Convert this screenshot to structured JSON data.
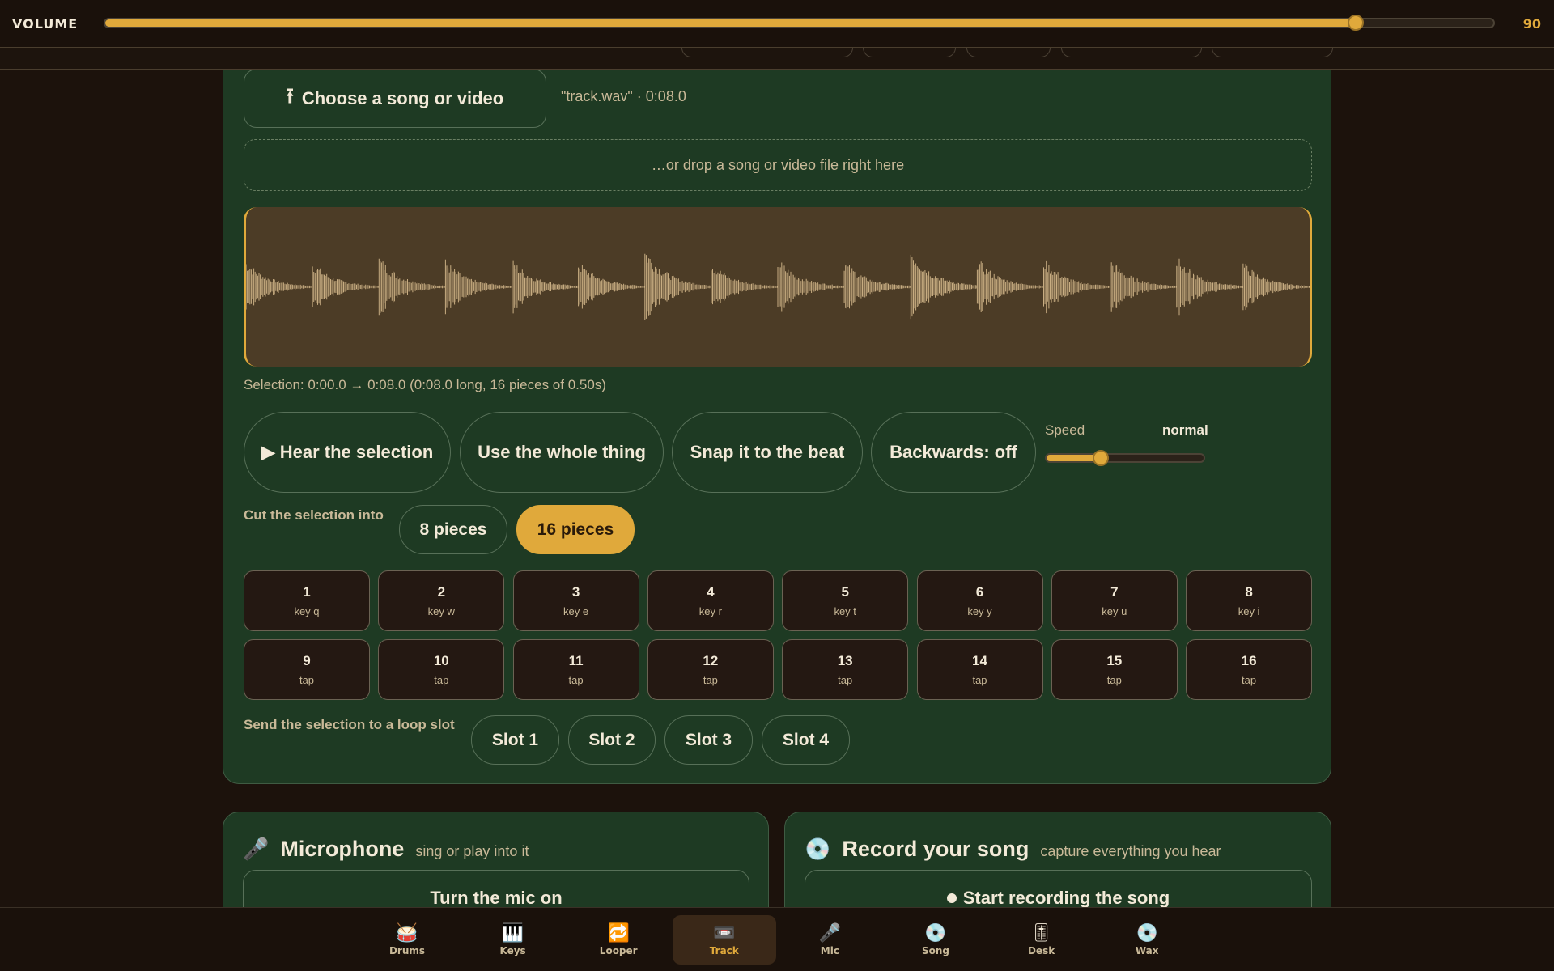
{
  "volume": {
    "label": "VOLUME",
    "value": "90",
    "level": 0.9
  },
  "track": {
    "choose_icon": "upload-icon",
    "choose_label": "Choose a song or video",
    "file_info": "\"track.wav\" · 0:08.0",
    "dropzone_text": "…or drop a song or video file right here",
    "selection_text": "Selection: 0:00.0 → 0:08.0 (0:08.0 long, 16 pieces of 0.50s)",
    "buttons": {
      "hear": "▶ Hear the selection",
      "whole": "Use the whole thing",
      "snap": "Snap it to the beat",
      "backwards": "Backwards: off"
    },
    "speed": {
      "label": "Speed",
      "value": "normal",
      "level": 0.35
    },
    "cut_label": "Cut the selection into",
    "cut_options": [
      "8 pieces",
      "16 pieces"
    ],
    "cut_selected": "16 pieces",
    "pads": [
      {
        "num": "1",
        "sub": "key q"
      },
      {
        "num": "2",
        "sub": "key w"
      },
      {
        "num": "3",
        "sub": "key e"
      },
      {
        "num": "4",
        "sub": "key r"
      },
      {
        "num": "5",
        "sub": "key t"
      },
      {
        "num": "6",
        "sub": "key y"
      },
      {
        "num": "7",
        "sub": "key u"
      },
      {
        "num": "8",
        "sub": "key i"
      },
      {
        "num": "9",
        "sub": "tap"
      },
      {
        "num": "10",
        "sub": "tap"
      },
      {
        "num": "11",
        "sub": "tap"
      },
      {
        "num": "12",
        "sub": "tap"
      },
      {
        "num": "13",
        "sub": "tap"
      },
      {
        "num": "14",
        "sub": "tap"
      },
      {
        "num": "15",
        "sub": "tap"
      },
      {
        "num": "16",
        "sub": "tap"
      }
    ],
    "send_label": "Send the selection to a loop slot",
    "slots": [
      "Slot 1",
      "Slot 2",
      "Slot 3",
      "Slot 4"
    ],
    "waveform": {
      "color_wave": "#c8ad82",
      "color_bg": "#4c3c26",
      "color_edge": "#e0a93b"
    }
  },
  "microphone": {
    "icon": "microphone-icon",
    "emoji": "🎤",
    "title": "Microphone",
    "subtitle": "sing or play into it",
    "button": "Turn the mic on"
  },
  "record": {
    "icon": "disc-icon",
    "emoji": "💿",
    "title": "Record your song",
    "subtitle": "capture everything you hear",
    "button": "Start recording the song"
  },
  "nav": [
    {
      "label": "Drums",
      "icon": "drum-icon",
      "glyph": "🥁"
    },
    {
      "label": "Keys",
      "icon": "piano-icon",
      "glyph": "🎹"
    },
    {
      "label": "Looper",
      "icon": "loop-icon",
      "glyph": "🔁"
    },
    {
      "label": "Track",
      "icon": "cassette-icon",
      "glyph": "📼"
    },
    {
      "label": "Mic",
      "icon": "microphone-icon",
      "glyph": "🎤"
    },
    {
      "label": "Song",
      "icon": "disc-icon",
      "glyph": "💿"
    },
    {
      "label": "Desk",
      "icon": "mixer-icon",
      "glyph": "🎚"
    },
    {
      "label": "Wax",
      "icon": "record-icon",
      "glyph": "💿"
    }
  ],
  "nav_active": "Track",
  "colors": {
    "accent": "#e0a93b",
    "panel": "#1e3a23",
    "background": "#1c120c"
  }
}
